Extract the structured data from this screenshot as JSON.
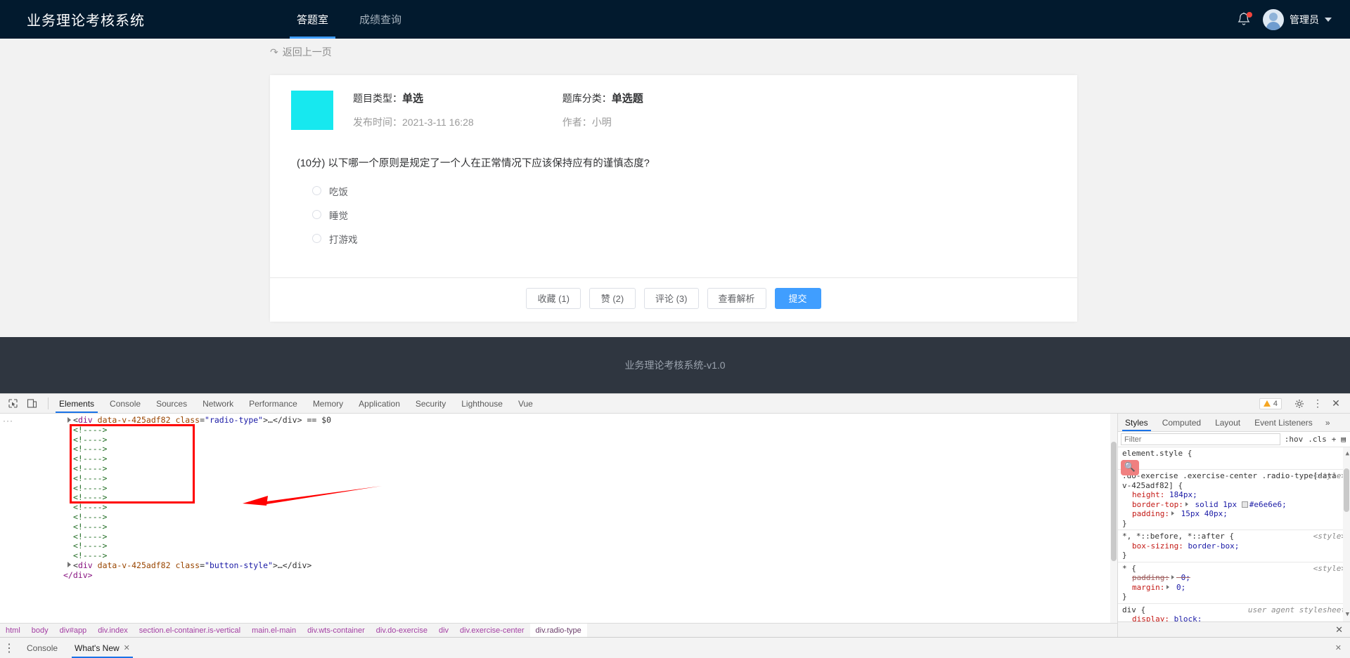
{
  "app": {
    "brand": "业务理论考核系统",
    "nav": [
      {
        "label": "答题室",
        "active": true
      },
      {
        "label": "成绩查询",
        "active": false
      }
    ],
    "user": {
      "name": "管理员",
      "avatar_icon": "user-avatar",
      "bell_icon": "bell-icon",
      "chevron_icon": "chevron-down-icon"
    },
    "back_link": {
      "label": "返回上一页",
      "icon": "back-arrow-icon"
    },
    "question": {
      "thumb_color": "#17e8ef",
      "type_label": "题目类型：",
      "type_value": "单选",
      "category_label": "题库分类：",
      "category_value": "单选题",
      "publish_label": "发布时间：",
      "publish_value": "2021-3-11 16:28",
      "author_label": "作者：",
      "author_value": "小明",
      "text": "(10分) 以下哪一个原则是规定了一个人在正常情况下应该保持应有的谨慎态度?",
      "options": [
        {
          "label": "吃饭",
          "selected": false
        },
        {
          "label": "睡觉",
          "selected": false
        },
        {
          "label": "打游戏",
          "selected": false
        }
      ],
      "buttons": [
        {
          "label": "收藏 (1)",
          "primary": false
        },
        {
          "label": "赞 (2)",
          "primary": false
        },
        {
          "label": "评论 (3)",
          "primary": false
        },
        {
          "label": "查看解析",
          "primary": false
        },
        {
          "label": "提交",
          "primary": true
        }
      ]
    },
    "footer": "业务理论考核系统-v1.0",
    "accent_color": "#409eff",
    "header_bg": "#021a2e",
    "footer_bg": "#2f3640"
  },
  "devtools": {
    "toolbar": {
      "inspect_icon": "inspect-element-icon",
      "device_icon": "device-toolbar-icon",
      "tabs": [
        {
          "label": "Elements",
          "active": true
        },
        {
          "label": "Console",
          "active": false
        },
        {
          "label": "Sources",
          "active": false
        },
        {
          "label": "Network",
          "active": false
        },
        {
          "label": "Performance",
          "active": false
        },
        {
          "label": "Memory",
          "active": false
        },
        {
          "label": "Application",
          "active": false
        },
        {
          "label": "Security",
          "active": false
        },
        {
          "label": "Lighthouse",
          "active": false
        },
        {
          "label": "Vue",
          "active": false
        }
      ],
      "warning_count": "4",
      "settings_icon": "gear-icon",
      "kebab_icon": "more-options-icon",
      "close_icon": "close-icon"
    },
    "dom": {
      "ellipsis": "···",
      "selected_line": {
        "tag": "div",
        "attr_name": "data-v-425adf82",
        "class_name": "class",
        "class_value": "\"radio-type\"",
        "open": "<",
        "collapsed": ">…</div>",
        "selection_marker": "== $0"
      },
      "comment_lines": 14,
      "comment_text": "<!---->",
      "button_line": {
        "open": "<",
        "tag": "div",
        "attr_name": "data-v-425adf82",
        "class_name": "class",
        "class_value": "\"button-style\"",
        "collapsed": ">…</div>"
      },
      "close_line": "</div>",
      "breadcrumb": [
        {
          "label": "html",
          "active": false
        },
        {
          "label": "body",
          "active": false
        },
        {
          "label": "div#app",
          "active": false
        },
        {
          "label": "div.index",
          "active": false
        },
        {
          "label": "section.el-container.is-vertical",
          "active": false
        },
        {
          "label": "main.el-main",
          "active": false
        },
        {
          "label": "div.wts-container",
          "active": false
        },
        {
          "label": "div.do-exercise",
          "active": false
        },
        {
          "label": "div",
          "active": false
        },
        {
          "label": "div.exercise-center",
          "active": false
        },
        {
          "label": "div.radio-type",
          "active": true
        }
      ]
    },
    "styles": {
      "tabs": [
        {
          "label": "Styles",
          "active": true
        },
        {
          "label": "Computed",
          "active": false
        },
        {
          "label": "Layout",
          "active": false
        },
        {
          "label": "Event Listeners",
          "active": false
        }
      ],
      "more_label": "»",
      "filter_placeholder": "Filter",
      "hov_label": ":hov",
      "cls_label": ".cls",
      "plus_label": "+",
      "sidebar_toggle_icon": "panel-toggle-icon",
      "magnifier_icon": "search-icon",
      "rules": [
        {
          "selector": "element.style {",
          "origin": "",
          "close": "}",
          "props": []
        },
        {
          "selector": ".do-exercise .exercise-center .radio-type[data-v-425adf82] {",
          "origin": "<style>",
          "close": "}",
          "props": [
            {
              "name": "height",
              "value": "184px;",
              "expander": false,
              "swatch": "",
              "struck": false
            },
            {
              "name": "border-top",
              "value": "solid 1px",
              "expander": true,
              "swatch": "#e6e6e6",
              "swatch_text": "#e6e6e6;",
              "struck": false
            },
            {
              "name": "padding",
              "value": "15px 40px;",
              "expander": true,
              "swatch": "",
              "struck": false
            }
          ]
        },
        {
          "selector": "*, *::before, *::after {",
          "origin": "<style>",
          "close": "}",
          "props": [
            {
              "name": "box-sizing",
              "value": "border-box;",
              "expander": false,
              "swatch": "",
              "struck": false
            }
          ]
        },
        {
          "selector": "* {",
          "origin": "<style>",
          "close": "}",
          "props": [
            {
              "name": "padding",
              "value": "0;",
              "expander": true,
              "swatch": "",
              "struck": true
            },
            {
              "name": "margin",
              "value": "0;",
              "expander": true,
              "swatch": "",
              "struck": false
            }
          ]
        },
        {
          "selector": "div {",
          "origin": "user agent stylesheet",
          "close": "",
          "props": [
            {
              "name": "display",
              "value": "block;",
              "expander": false,
              "swatch": "",
              "struck": false
            }
          ]
        }
      ],
      "close_icon": "close-icon"
    },
    "drawer": {
      "kebab_icon": "more-options-icon",
      "tabs": [
        {
          "label": "Console",
          "active": false,
          "closable": false
        },
        {
          "label": "What's New",
          "active": true,
          "closable": true
        }
      ],
      "close_icon": "close-icon"
    }
  },
  "annotation": {
    "highlight_box_color": "#ff0000",
    "arrow_color": "#ff0000"
  }
}
